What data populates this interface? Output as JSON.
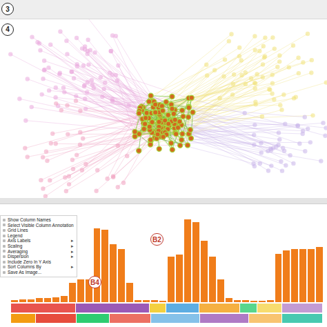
{
  "labels": {
    "top_strip": "3",
    "graph_panel": "4",
    "chart": "B2",
    "menu": "B4"
  },
  "graph": {
    "clusters": [
      {
        "name": "upper-left",
        "color": "#e9a7dc",
        "count": 70,
        "cx": 0.22,
        "cy": 0.28,
        "spread": 0.22,
        "faded": true
      },
      {
        "name": "upper-right",
        "color": "#f1e27a",
        "count": 60,
        "cx": 0.82,
        "cy": 0.3,
        "spread": 0.2,
        "faded": true
      },
      {
        "name": "lower-left",
        "color": "#f0a0c0",
        "count": 40,
        "cx": 0.25,
        "cy": 0.72,
        "spread": 0.2,
        "faded": true
      },
      {
        "name": "right",
        "color": "#c9b4ea",
        "count": 40,
        "cx": 0.85,
        "cy": 0.7,
        "spread": 0.18,
        "faded": true
      },
      {
        "name": "highlighted",
        "color": "#d2691e",
        "count": 110,
        "cx": 0.5,
        "cy": 0.56,
        "spread": 0.11,
        "faded": false
      }
    ]
  },
  "chart": {
    "series": [
      {
        "name": "values",
        "color": "#f07d1a",
        "values": [
          3,
          4,
          4,
          5,
          5,
          6,
          8,
          25,
          30,
          30,
          97,
          95,
          76,
          70,
          25,
          3,
          3,
          3,
          2,
          60,
          62,
          108,
          105,
          80,
          60,
          30,
          5,
          3,
          3,
          2,
          2,
          3,
          63,
          68,
          70,
          70,
          70,
          72
        ]
      }
    ],
    "annotations": [
      [
        {
          "color": "#e8544e",
          "span": 8
        },
        {
          "color": "#9b59b6",
          "span": 9
        },
        {
          "color": "#f4d03f",
          "span": 2
        },
        {
          "color": "#5dade2",
          "span": 4
        },
        {
          "color": "#f5b041",
          "span": 5
        },
        {
          "color": "#58d68d",
          "span": 2
        },
        {
          "color": "#f7dc6f",
          "span": 3
        },
        {
          "color": "#c39bd3",
          "span": 5
        }
      ],
      [
        {
          "color": "#f39c12",
          "span": 3
        },
        {
          "color": "#e74c3c",
          "span": 5
        },
        {
          "color": "#2ecc71",
          "span": 4
        },
        {
          "color": "#ec7063",
          "span": 5
        },
        {
          "color": "#85c1e9",
          "span": 6
        },
        {
          "color": "#af7ac5",
          "span": 6
        },
        {
          "color": "#f8c471",
          "span": 4
        },
        {
          "color": "#48c9b0",
          "span": 5
        }
      ]
    ]
  },
  "context_menu": {
    "items": [
      {
        "label": "Show Column Names",
        "arrow": ""
      },
      {
        "label": "Select Visible Column Annotation",
        "arrow": ""
      },
      {
        "label": "Grid Lines",
        "arrow": ""
      },
      {
        "label": "Legend",
        "arrow": ""
      },
      {
        "label": "Axis Labels",
        "arrow": "▸"
      },
      {
        "label": "Scaling",
        "arrow": "▸"
      },
      {
        "label": "Averaging",
        "arrow": "▸"
      },
      {
        "label": "Dispersion",
        "arrow": "▸"
      },
      {
        "label": "Include Zero In Y Axis",
        "arrow": ""
      },
      {
        "label": "Sort Columns By",
        "arrow": "▸"
      },
      {
        "label": "Save As Image...",
        "arrow": ""
      }
    ]
  }
}
